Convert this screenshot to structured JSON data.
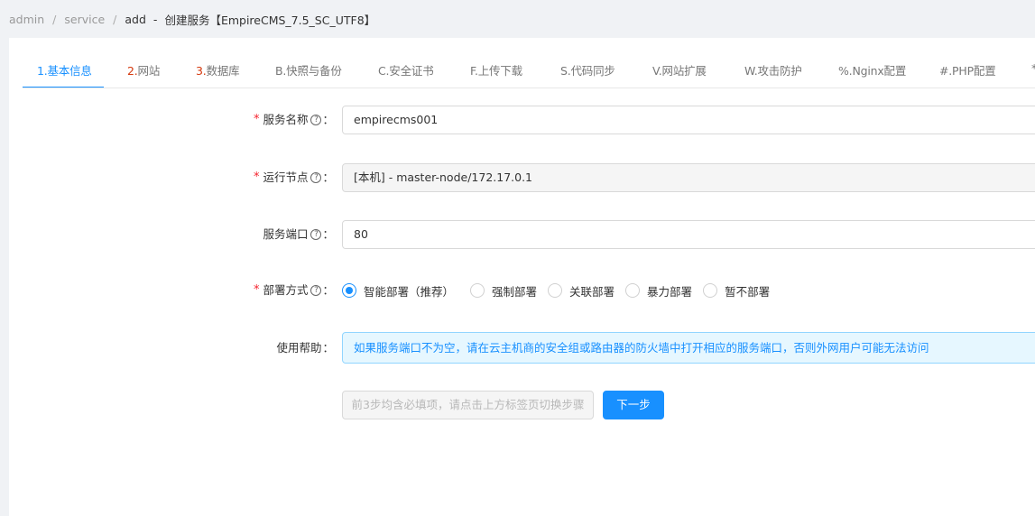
{
  "breadcrumb": {
    "items": [
      "admin",
      "service",
      "add"
    ],
    "separator": "/",
    "dash": "-",
    "title": "创建服务【EmpireCMS_7.5_SC_UTF8】"
  },
  "tabs": [
    {
      "num": "1.",
      "label": "基本信息",
      "active": true
    },
    {
      "num": "2.",
      "label": "网站"
    },
    {
      "num": "3.",
      "label": "数据库"
    },
    {
      "label": "B.快照与备份"
    },
    {
      "label": "C.安全证书"
    },
    {
      "label": "F.上传下载"
    },
    {
      "label": "S.代码同步"
    },
    {
      "label": "V.网站扩展"
    },
    {
      "label": "W.攻击防护"
    },
    {
      "label": "%.Nginx配置"
    },
    {
      "label": "#.PHP配置"
    },
    {
      "label": "*"
    }
  ],
  "form": {
    "service_name": {
      "label": "服务名称",
      "value": "empirecms001",
      "required": true
    },
    "node": {
      "label": "运行节点",
      "value": "[本机] - master-node/172.17.0.1",
      "required": true
    },
    "port": {
      "label": "服务端口",
      "value": "80"
    },
    "deploy": {
      "label": "部署方式",
      "required": true,
      "options": [
        "智能部署（推荐）",
        "强制部署",
        "关联部署",
        "暴力部署",
        "暂不部署"
      ],
      "selected": "智能部署（推荐）"
    },
    "help": {
      "label": "使用帮助",
      "text": "如果服务端口不为空，请在云主机商的安全组或路由器的防火墙中打开相应的服务端口，否则外网用户可能无法访问"
    },
    "hint_button": "前3步均含必填项，请点击上方标签页切换步骤",
    "next_button": "下一步"
  },
  "symbols": {
    "required": "*",
    "help": "?",
    "colon": "："
  },
  "colors": {
    "primary": "#1890ff",
    "required": "#f5222d",
    "tab_number": "#d4380d"
  }
}
